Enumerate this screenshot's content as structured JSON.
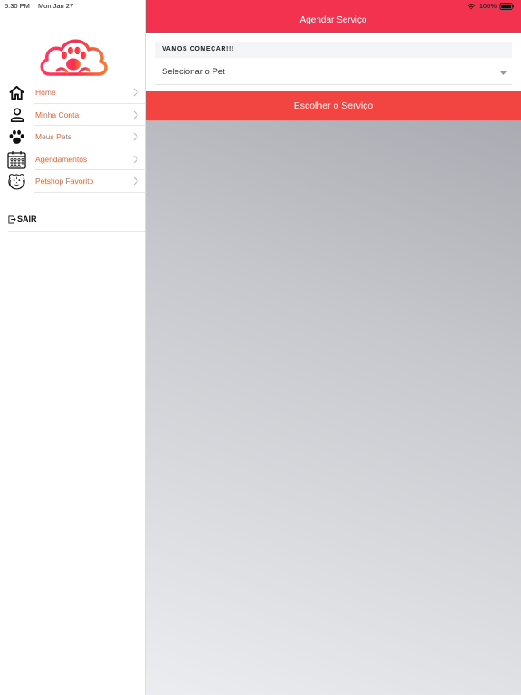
{
  "status_bar": {
    "time": "5:30 PM",
    "date": "Mon Jan 27",
    "battery": "100%"
  },
  "header": {
    "title": "Agendar Serviço"
  },
  "form": {
    "section_title": "VAMOS COMEÇAR!!!",
    "pet_select": {
      "value": "Selecionar o Pet"
    },
    "service_button": "Escolher o Serviço"
  },
  "sidebar": {
    "items": [
      {
        "label": "Home",
        "icon": "home-icon"
      },
      {
        "label": "Minha Conta",
        "icon": "user-icon"
      },
      {
        "label": "Meus Pets",
        "icon": "paw-icon"
      },
      {
        "label": "Agendamentos",
        "icon": "calendar-icon"
      },
      {
        "label": "Petshop Favorito",
        "icon": "dog-cat-icon"
      }
    ],
    "logout_label": "SAIR"
  },
  "colors": {
    "accent": "#f2324f",
    "button": "#f24440",
    "menu_text": "#e0643a"
  }
}
